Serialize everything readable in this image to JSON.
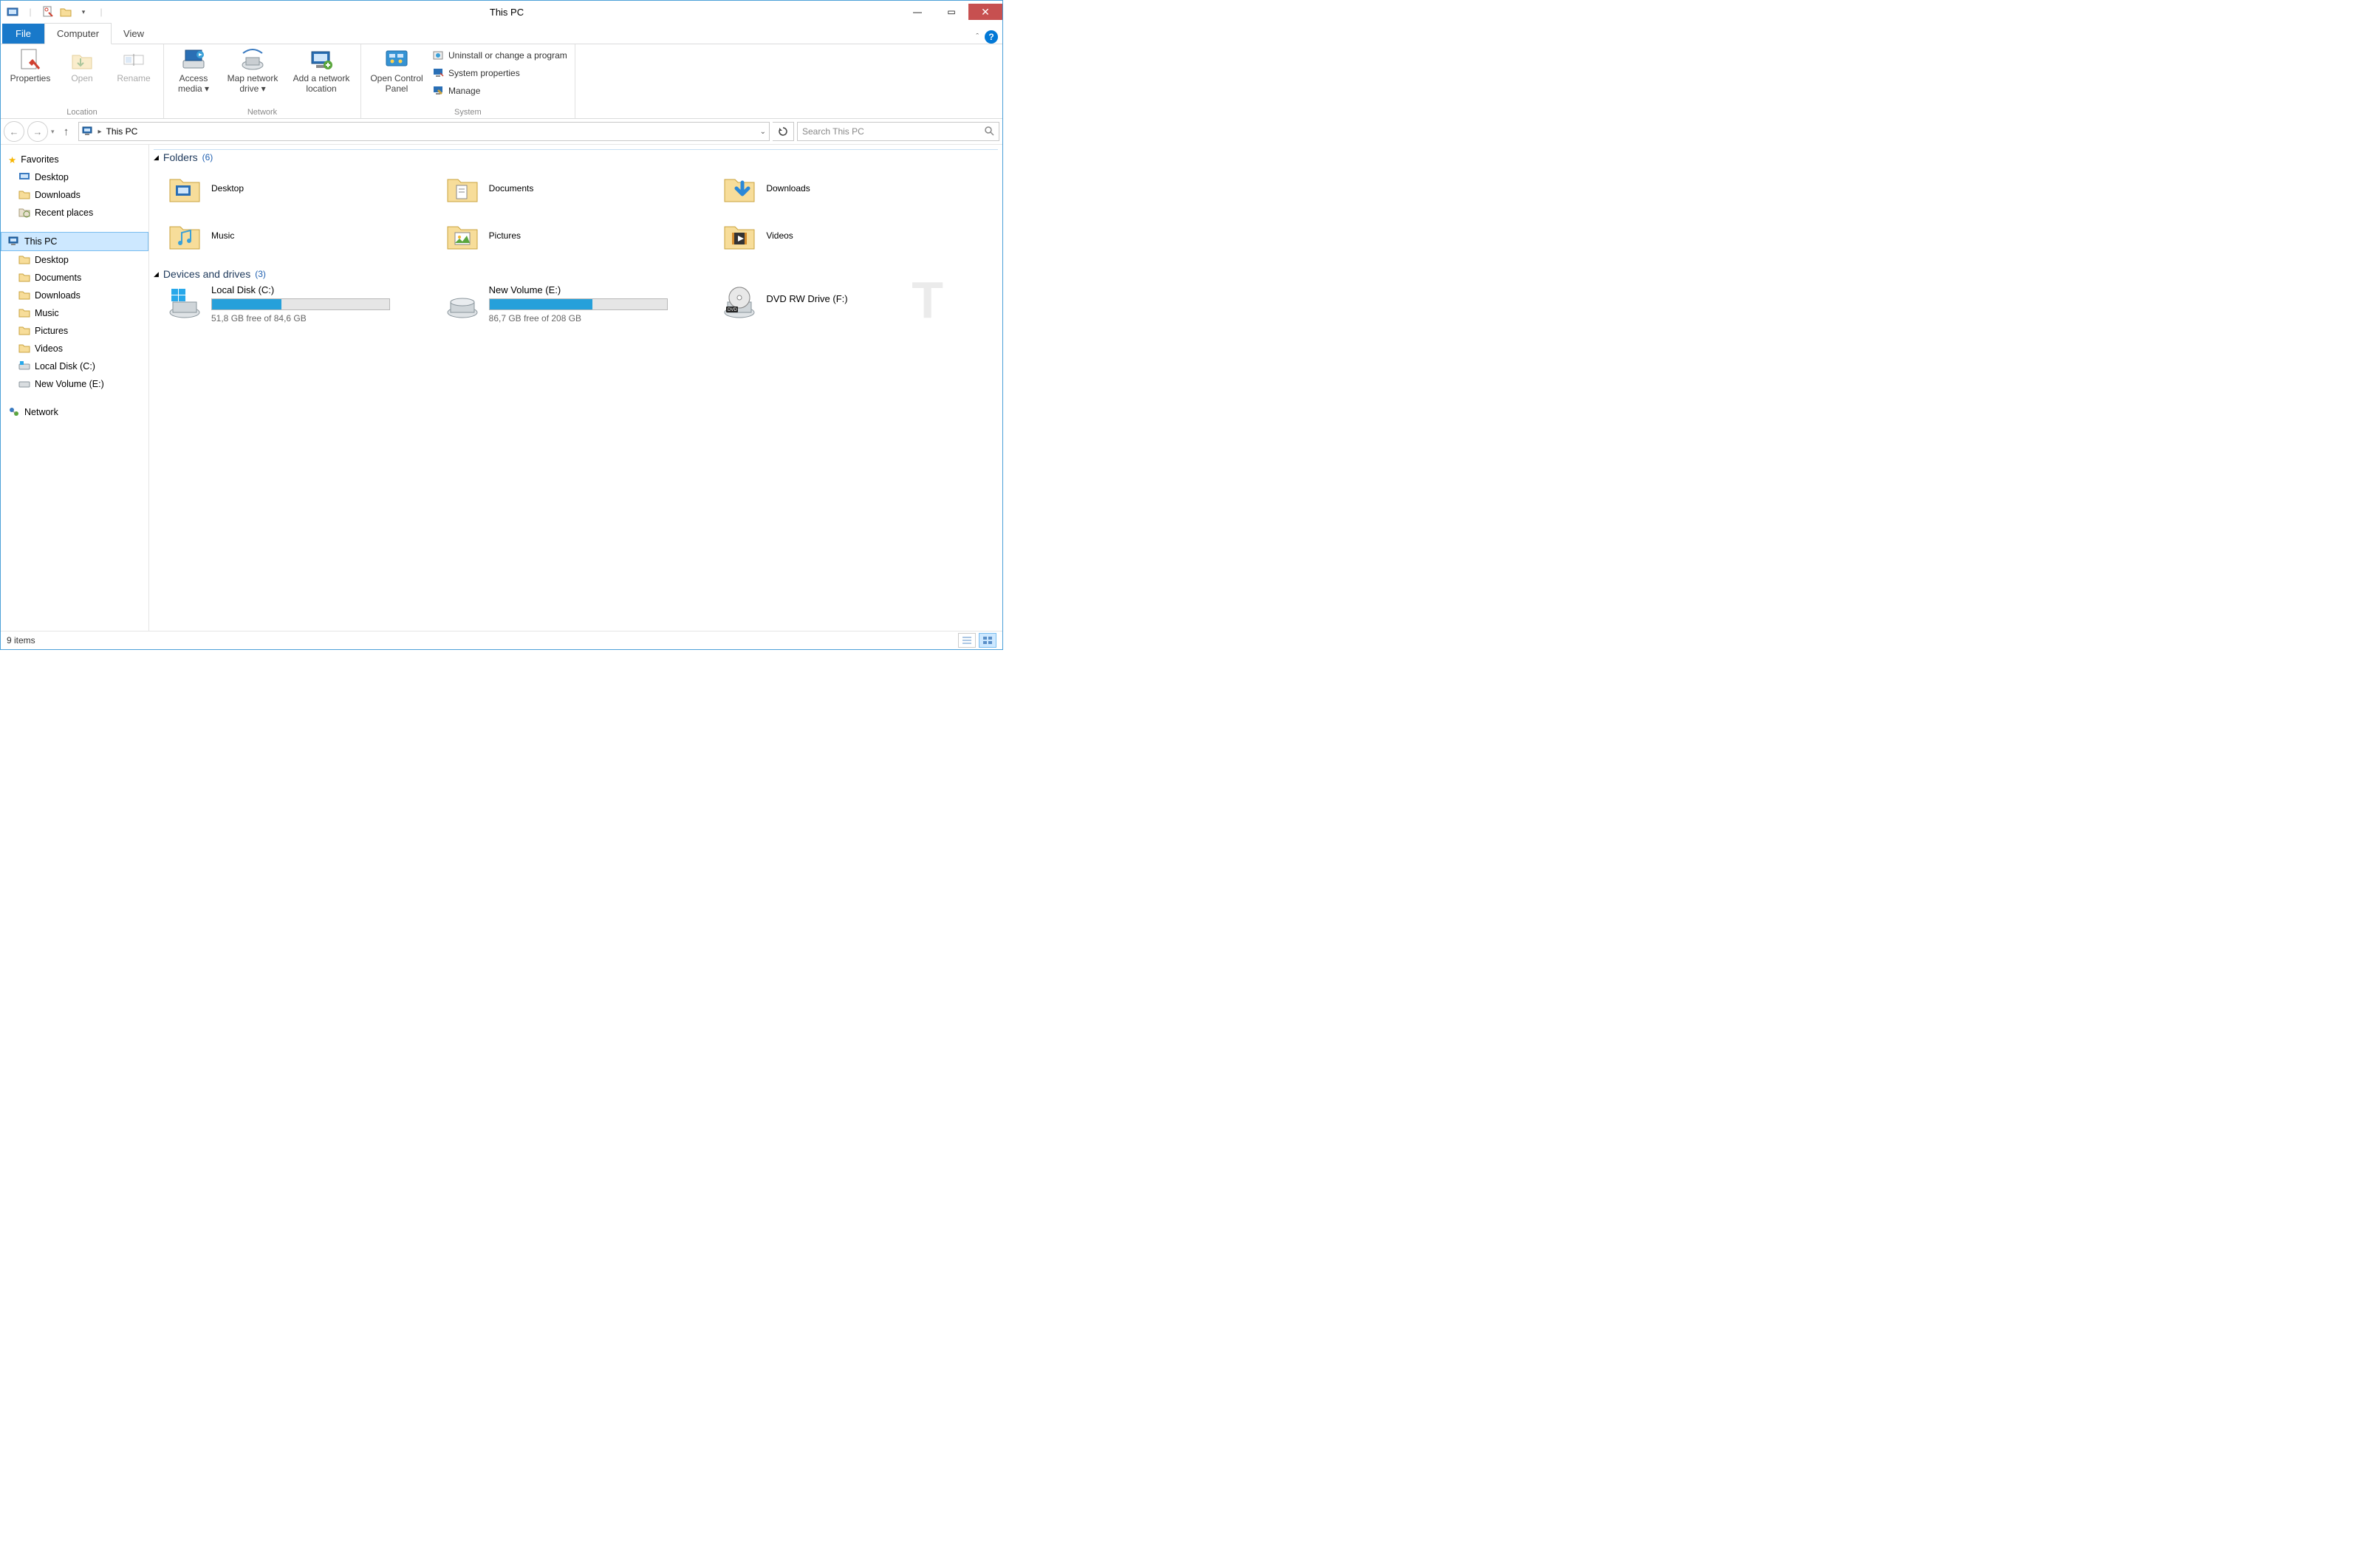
{
  "window": {
    "title": "This PC"
  },
  "tabs": {
    "file": "File",
    "computer": "Computer",
    "view": "View"
  },
  "ribbon": {
    "location": {
      "label": "Location",
      "properties": "Properties",
      "open": "Open",
      "rename": "Rename"
    },
    "network": {
      "label": "Network",
      "access_media": "Access media",
      "map_drive": "Map network drive",
      "add_location": "Add a network location"
    },
    "system": {
      "label": "System",
      "control_panel": "Open Control Panel",
      "uninstall": "Uninstall or change a program",
      "sysprops": "System properties",
      "manage": "Manage"
    }
  },
  "nav": {
    "breadcrumb": "This PC",
    "search_placeholder": "Search This PC"
  },
  "sidebar": {
    "favorites": "Favorites",
    "desktop": "Desktop",
    "downloads": "Downloads",
    "recent": "Recent places",
    "thispc": "This PC",
    "pc_desktop": "Desktop",
    "pc_documents": "Documents",
    "pc_downloads": "Downloads",
    "pc_music": "Music",
    "pc_pictures": "Pictures",
    "pc_videos": "Videos",
    "pc_localc": "Local Disk (C:)",
    "pc_vole": "New Volume (E:)",
    "network": "Network"
  },
  "groups": {
    "folders_title": "Folders",
    "folders_count": "(6)",
    "drives_title": "Devices and drives",
    "drives_count": "(3)"
  },
  "folders": {
    "desktop": "Desktop",
    "documents": "Documents",
    "downloads": "Downloads",
    "music": "Music",
    "pictures": "Pictures",
    "videos": "Videos"
  },
  "drives": {
    "c": {
      "name": "Local Disk (C:)",
      "free": "51,8 GB free of 84,6 GB",
      "fill_pct": 39
    },
    "e": {
      "name": "New Volume (E:)",
      "free": "86,7 GB free of 208 GB",
      "fill_pct": 58
    },
    "f": {
      "name": "DVD RW Drive (F:)"
    }
  },
  "status": {
    "items": "9 items"
  }
}
